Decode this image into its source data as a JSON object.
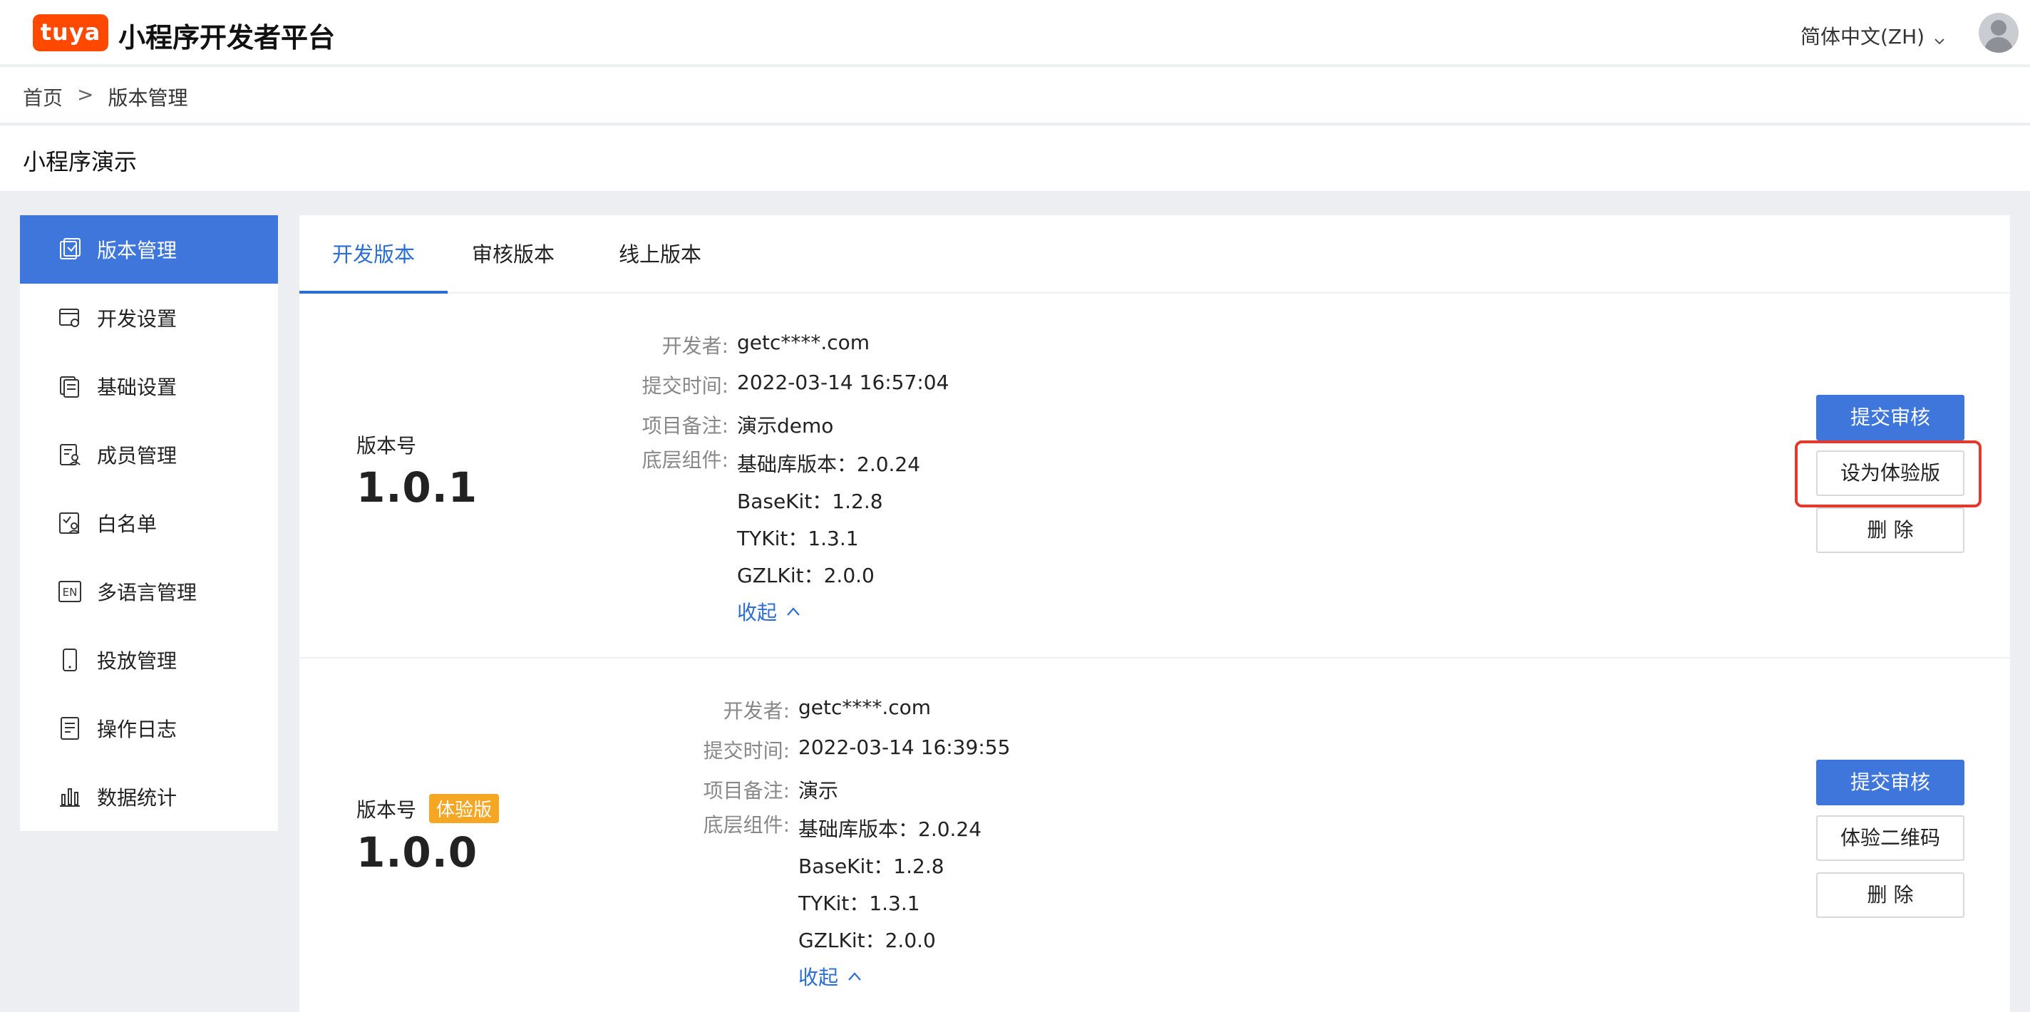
{
  "header": {
    "logo_text": "tuya",
    "app_title": "小程序开发者平台",
    "language": "简体中文(ZH)"
  },
  "breadcrumb": {
    "home": "首页",
    "separator": ">",
    "current": "版本管理"
  },
  "project_title": "小程序演示",
  "sidebar": {
    "items": [
      {
        "label": "版本管理",
        "icon": "version-icon",
        "active": true
      },
      {
        "label": "开发设置",
        "icon": "dev-settings-icon",
        "active": false
      },
      {
        "label": "基础设置",
        "icon": "basic-settings-icon",
        "active": false
      },
      {
        "label": "成员管理",
        "icon": "member-icon",
        "active": false
      },
      {
        "label": "白名单",
        "icon": "whitelist-icon",
        "active": false
      },
      {
        "label": "多语言管理",
        "icon": "language-icon",
        "active": false
      },
      {
        "label": "投放管理",
        "icon": "phone-icon",
        "active": false
      },
      {
        "label": "操作日志",
        "icon": "log-icon",
        "active": false
      },
      {
        "label": "数据统计",
        "icon": "chart-icon",
        "active": false
      }
    ]
  },
  "tabs": [
    {
      "label": "开发版本",
      "active": true
    },
    {
      "label": "审核版本",
      "active": false
    },
    {
      "label": "线上版本",
      "active": false
    }
  ],
  "labels": {
    "version_label": "版本号",
    "developer": "开发者:",
    "submit_time": "提交时间:",
    "remark": "项目备注:",
    "components": "底层组件:",
    "collapse": "收起"
  },
  "versions": [
    {
      "version": "1.0.1",
      "badge": "",
      "developer": "getc****.com",
      "submit_time": "2022-03-14 16:57:04",
      "remark": "演示demo",
      "components": [
        "基础库版本：2.0.24",
        "BaseKit：1.2.8",
        "TYKit：1.3.1",
        "GZLKit：2.0.0"
      ],
      "buttons": [
        "提交审核",
        "设为体验版",
        "删 除"
      ]
    },
    {
      "version": "1.0.0",
      "badge": "体验版",
      "developer": "getc****.com",
      "submit_time": "2022-03-14 16:39:55",
      "remark": "演示",
      "components": [
        "基础库版本：2.0.24",
        "BaseKit：1.2.8",
        "TYKit：1.3.1",
        "GZLKit：2.0.0"
      ],
      "buttons": [
        "提交审核",
        "体验二维码",
        "删 除"
      ]
    }
  ],
  "colors": {
    "primary": "#3e76dc",
    "link": "#2a6ed6",
    "brand": "#ff4800",
    "badge": "#f5a623",
    "highlight": "#e23b2e"
  }
}
